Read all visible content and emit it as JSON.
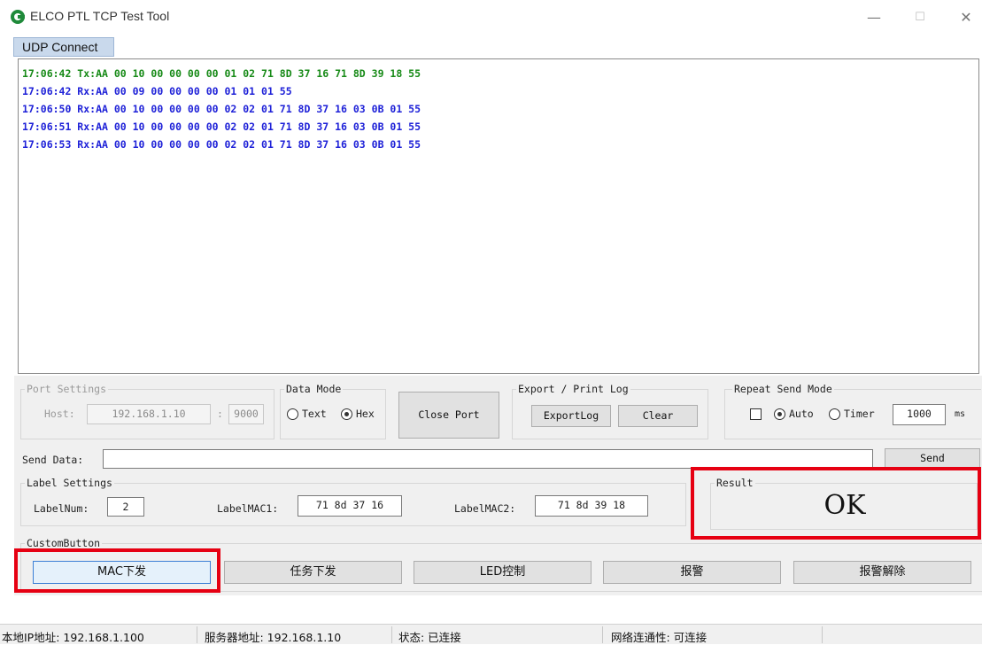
{
  "window": {
    "title": "ELCO PTL TCP Test Tool",
    "minimize": "—",
    "maximize": "☐",
    "close": "✕"
  },
  "tab": {
    "label": "UDP Connect"
  },
  "log": {
    "lines": [
      {
        "text": "17:06:42 Tx:AA 00 10 00 00 00 00 01 02 71 8D 37 16 71 8D 39 18 55",
        "color": "#178a17"
      },
      {
        "text": "17:06:42 Rx:AA 00 09 00 00 00 00 01 01 01 55",
        "color": "#1f22d8"
      },
      {
        "text": "17:06:50 Rx:AA 00 10 00 00 00 00 02 02 01 71 8D 37 16 03 0B 01 55",
        "color": "#1f22d8"
      },
      {
        "text": "17:06:51 Rx:AA 00 10 00 00 00 00 02 02 01 71 8D 37 16 03 0B 01 55",
        "color": "#1f22d8"
      },
      {
        "text": "17:06:53 Rx:AA 00 10 00 00 00 00 02 02 01 71 8D 37 16 03 0B 01 55",
        "color": "#1f22d8"
      }
    ]
  },
  "port_settings": {
    "legend": "Port Settings",
    "host_label": "Host:",
    "host_value": "192.168.1.10",
    "colon": ":",
    "port_value": "9000"
  },
  "data_mode": {
    "legend": "Data Mode",
    "text_label": "Text",
    "hex_label": "Hex",
    "selected": "Hex"
  },
  "close_port_button": "Close Port",
  "export_log": {
    "legend": "Export / Print Log",
    "export_button": "ExportLog",
    "clear_button": "Clear"
  },
  "repeat_send": {
    "legend": "Repeat Send Mode",
    "auto_label": "Auto",
    "timer_label": "Timer",
    "selected": "Auto",
    "interval_value": "1000",
    "unit": "ms"
  },
  "send": {
    "label": "Send Data:",
    "value": "",
    "button": "Send"
  },
  "label_settings": {
    "legend": "Label Settings",
    "labelnum_label": "LabelNum:",
    "labelnum_value": "2",
    "mac1_label": "LabelMAC1:",
    "mac1_value": "71 8d 37 16",
    "mac2_label": "LabelMAC2:",
    "mac2_value": "71 8d 39 18"
  },
  "result": {
    "legend": "Result",
    "value": "OK"
  },
  "custom_buttons": {
    "legend": "CustomButton",
    "items": [
      "MAC下发",
      "任务下发",
      "LED控制",
      "报警",
      "报警解除"
    ]
  },
  "status_bar": {
    "local_ip": "本地IP地址: 192.168.1.100",
    "server_addr": "服务器地址: 192.168.1.10",
    "state": "状态: 已连接",
    "network": "网络连通性: 可连接"
  },
  "colors": {
    "highlight": "#e60012",
    "tx": "#178a17",
    "rx": "#1f22d8"
  }
}
